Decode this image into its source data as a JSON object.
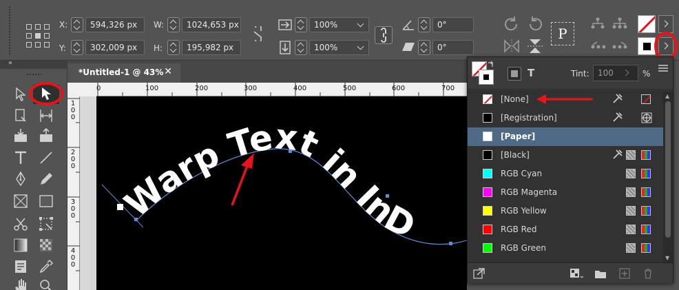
{
  "control_bar": {
    "x_label": "X:",
    "x_value": "594,326 px",
    "y_label": "Y:",
    "y_value": "302,009 px",
    "w_label": "W:",
    "w_value": "1024,653 px",
    "h_label": "H:",
    "h_value": "195,982 px",
    "scale_x": "100%",
    "scale_y": "100%",
    "rotate": "0°",
    "shear": "0°",
    "paragraph_glyph": "P"
  },
  "document_tab": {
    "title": "*Untitled-1 @ 43%",
    "close": "✕"
  },
  "ruler": {
    "h_ticks": [
      "0",
      "100",
      "200",
      "300",
      "400",
      "500",
      "600",
      "700"
    ],
    "v_ticks": [
      "1\n0\n0",
      "2\n0\n0",
      "3\n0\n0",
      "4\n0\n0"
    ]
  },
  "canvas": {
    "warped_text": "Warp Text in InD"
  },
  "swatches_panel": {
    "tint_label": "Tint:",
    "tint_value": "100",
    "percent": "%",
    "type_glyph": "T",
    "swatches": [
      {
        "name": "[None]",
        "color": "none"
      },
      {
        "name": "[Registration]",
        "color": "#000000"
      },
      {
        "name": "[Paper]",
        "color": "#ffffff",
        "selected": true
      },
      {
        "name": "[Black]",
        "color": "#000000"
      },
      {
        "name": "RGB Cyan",
        "color": "#00ffff"
      },
      {
        "name": "RGB Magenta",
        "color": "#ff00ff"
      },
      {
        "name": "RGB Yellow",
        "color": "#ffff00"
      },
      {
        "name": "RGB Red",
        "color": "#ff0000"
      },
      {
        "name": "RGB Green",
        "color": "#00ff00"
      }
    ]
  },
  "colors": {
    "highlight_red": "#e8141b",
    "selection_blue": "#4f6a86",
    "path_blue": "#5b8fd6"
  }
}
